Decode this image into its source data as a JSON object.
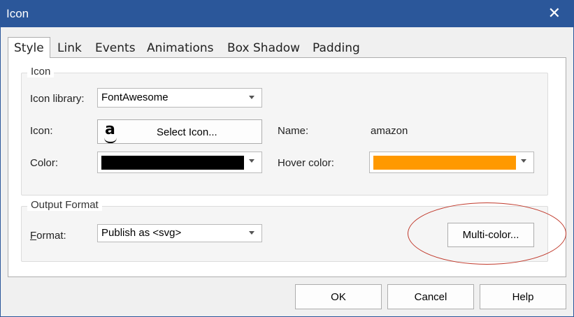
{
  "window": {
    "title": "Icon",
    "close_glyph": "✕"
  },
  "tabs": [
    {
      "label": "Style",
      "active": true
    },
    {
      "label": "Link"
    },
    {
      "label": "Events"
    },
    {
      "label": "Animations"
    },
    {
      "label": "Box Shadow"
    },
    {
      "label": "Padding"
    }
  ],
  "icon_group": {
    "legend": "Icon",
    "library_label": "Icon library:",
    "library_value": "FontAwesome",
    "icon_label": "Icon:",
    "icon_glyph": "a",
    "icon_name": "amazon-icon",
    "select_button": "Select Icon...",
    "name_label": "Name:",
    "name_value": "amazon",
    "color_label": "Color:",
    "color_value": "#000000",
    "hover_label": "Hover color:",
    "hover_value": "#ff9900"
  },
  "output_group": {
    "legend": "Output Format",
    "format_label_first": "F",
    "format_label_rest": "ormat:",
    "format_value": "Publish as <svg>",
    "multicolor_button": "Multi-color..."
  },
  "footer": {
    "ok": "OK",
    "cancel": "Cancel",
    "help": "Help"
  },
  "annotation_color": "#c0392b",
  "accent": "#2b579a"
}
